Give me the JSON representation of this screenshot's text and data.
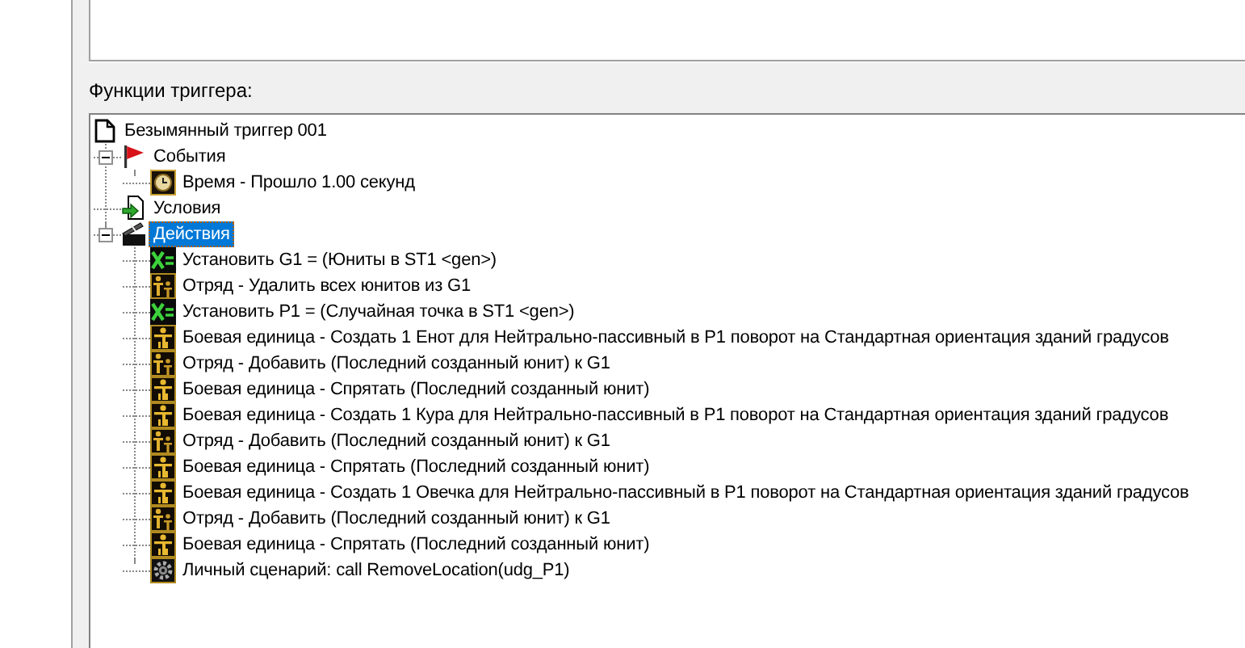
{
  "section_label": "Функции триггера:",
  "tree": {
    "label": "Безымянный триггер 001",
    "kind": "document",
    "selected": false,
    "children": [
      {
        "label": "События",
        "kind": "event",
        "selected": false,
        "expanded": true,
        "children": [
          {
            "label": "Время - Прошло 1.00 секунд",
            "kind": "clock",
            "selected": false
          }
        ]
      },
      {
        "label": "Условия",
        "kind": "condition",
        "selected": false
      },
      {
        "label": "Действия",
        "kind": "action",
        "selected": true,
        "expanded": true,
        "children": [
          {
            "label": "Установить G1 = (Юниты в ST1 <gen>)",
            "kind": "variable",
            "selected": false
          },
          {
            "label": "Отряд - Удалить всех юнитов из G1",
            "kind": "group",
            "selected": false
          },
          {
            "label": "Установить P1 = (Случайная точка в ST1 <gen>)",
            "kind": "variable",
            "selected": false
          },
          {
            "label": "Боевая единица - Создать 1 Енот для Нейтрально-пассивный в P1 поворот на Стандартная ориентация зданий градусов",
            "kind": "unit",
            "selected": false
          },
          {
            "label": "Отряд - Добавить (Последний созданный юнит) к G1",
            "kind": "group",
            "selected": false
          },
          {
            "label": "Боевая единица - Спрятать (Последний созданный юнит)",
            "kind": "unit",
            "selected": false
          },
          {
            "label": "Боевая единица - Создать 1 Кура для Нейтрально-пассивный в P1 поворот на Стандартная ориентация зданий градусов",
            "kind": "unit",
            "selected": false
          },
          {
            "label": "Отряд - Добавить (Последний созданный юнит) к G1",
            "kind": "group",
            "selected": false
          },
          {
            "label": "Боевая единица - Спрятать (Последний созданный юнит)",
            "kind": "unit",
            "selected": false
          },
          {
            "label": "Боевая единица - Создать 1 Овечка для Нейтрально-пассивный в P1 поворот на Стандартная ориентация зданий градусов",
            "kind": "unit",
            "selected": false
          },
          {
            "label": "Отряд - Добавить (Последний созданный юнит) к G1",
            "kind": "group",
            "selected": false
          },
          {
            "label": "Боевая единица - Спрятать (Последний созданный юнит)",
            "kind": "unit",
            "selected": false
          },
          {
            "label": "Личный сценарий: call RemoveLocation(udg_P1)",
            "kind": "script",
            "selected": false
          }
        ]
      }
    ]
  }
}
